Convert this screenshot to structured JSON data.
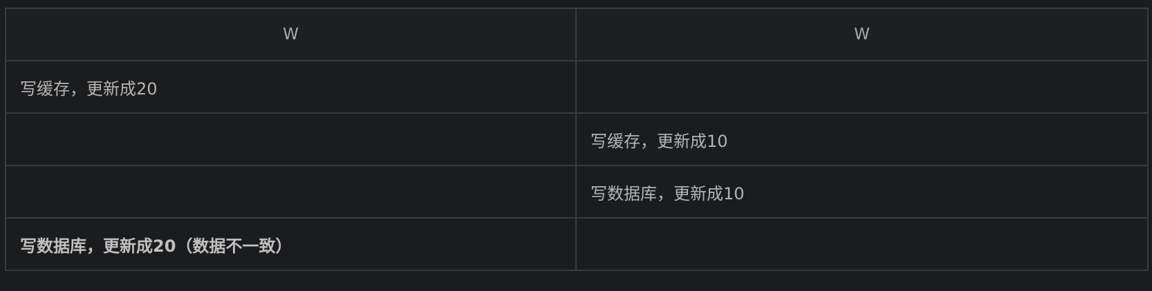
{
  "table": {
    "headers": [
      "W",
      "W"
    ],
    "rows": [
      [
        "写缓存，更新成20",
        ""
      ],
      [
        "",
        "写缓存，更新成10"
      ],
      [
        "",
        "写数据库，更新成10"
      ],
      [
        "写数据库，更新成20（数据不一致）",
        ""
      ]
    ]
  },
  "colors": {
    "background": "#1b1c1e",
    "border": "#3a3b3e",
    "text": "#b4b4b4"
  }
}
